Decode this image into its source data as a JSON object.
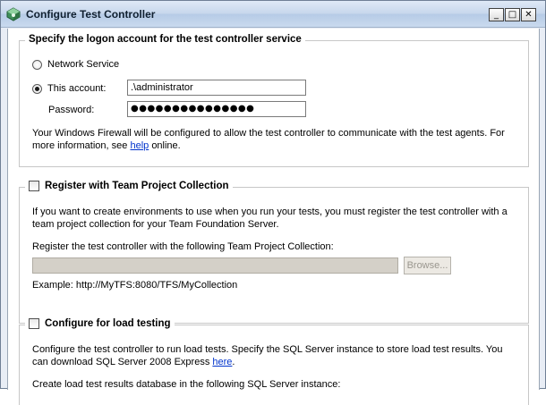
{
  "window": {
    "title": "Configure Test Controller",
    "min_glyph": "_",
    "max_glyph": "□",
    "close_glyph": "✕"
  },
  "logon": {
    "legend": "Specify the logon account for the test controller service",
    "network_service_label": "Network Service",
    "this_account_label": "This account:",
    "account_value": ".\\administrator",
    "password_label": "Password:",
    "password_value": "●●●●●●●●●●●●●●●",
    "firewall_text": "Your Windows Firewall will be configured to allow the test controller to communicate with the test agents. For more information, see",
    "firewall_link": "help",
    "firewall_suffix": "online.",
    "selected": "this_account"
  },
  "team_project": {
    "legend": "Register with Team Project Collection",
    "description": "If you want to create environments to use when you run your tests, you must register the test controller with a team project collection for your Team Foundation Server.",
    "register_label": "Register the test controller with the following Team Project Collection:",
    "collection_value": "",
    "browse_label": "Browse...",
    "example_text": "Example: http://MyTFS:8080/TFS/MyCollection",
    "checked": false
  },
  "load_testing": {
    "legend": "Configure for load testing",
    "description": "Configure the test controller to run load tests. Specify the SQL Server instance to store load test results. You can download SQL Server 2008 Express",
    "description_link": "here",
    "description_suffix": ".",
    "create_db_label": "Create load test results database in the following SQL Server instance:",
    "checked": false
  }
}
